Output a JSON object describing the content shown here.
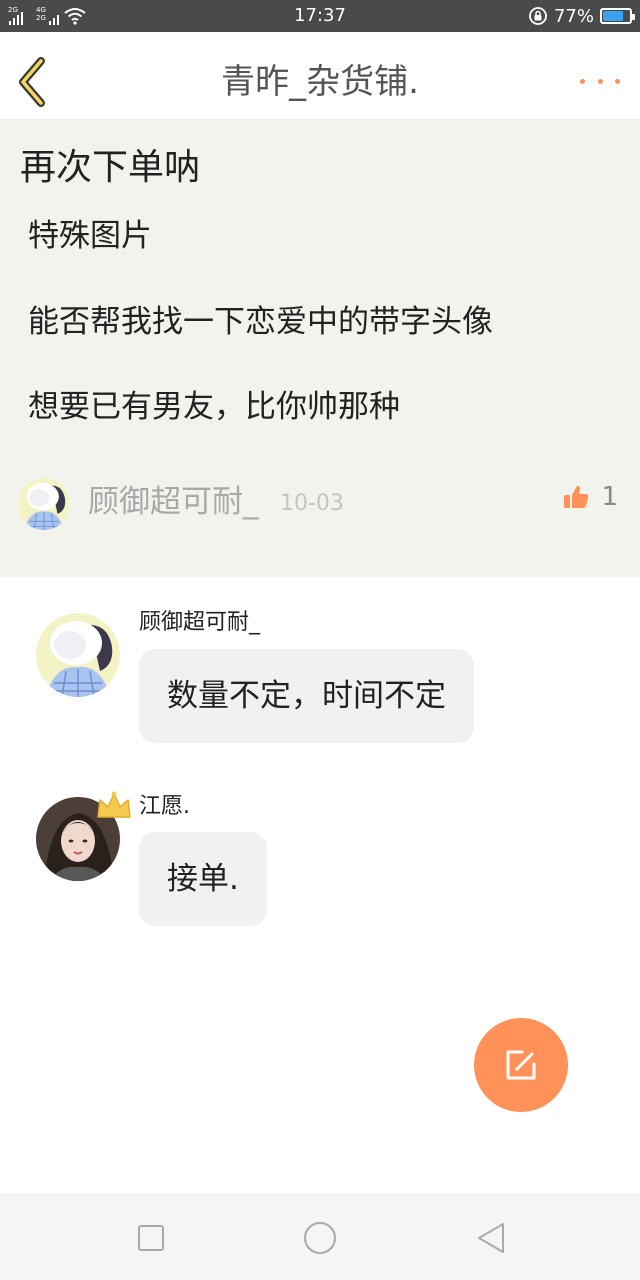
{
  "status_bar": {
    "network_1": "2G",
    "network_2": "4G",
    "network_2b": "2G",
    "time": "17:37",
    "battery_percent": "77%",
    "battery_level": 0.77,
    "battery_color": "#3aa2f0",
    "icons": [
      "signal-icon",
      "signal-icon",
      "wifi-icon",
      "rotation-lock-icon",
      "battery-icon"
    ]
  },
  "header": {
    "title": "青昨_杂货铺.",
    "back_icon": "chevron-left-icon",
    "more_icon": "more-dots-icon",
    "accent_color": "#ff9159"
  },
  "post": {
    "title": "再次下单呐",
    "lines": [
      "特殊图片",
      "能否帮我找一下恋爱中的带字头像",
      "想要已有男友，比你帅那种"
    ],
    "author": "顾御超可耐_",
    "date": "10-03",
    "like_icon": "thumbs-up-icon",
    "like_count": "1"
  },
  "replies": [
    {
      "name": "顾御超可耐_",
      "text": "数量不定，时间不定"
    },
    {
      "name": "江愿.",
      "text": "接单.",
      "badge_icon": "crown-icon"
    }
  ],
  "fab": {
    "icon": "edit-icon",
    "color": "#ff9159"
  },
  "nav_bar": {
    "icons": [
      "recents-square-icon",
      "home-circle-icon",
      "back-triangle-icon"
    ]
  }
}
